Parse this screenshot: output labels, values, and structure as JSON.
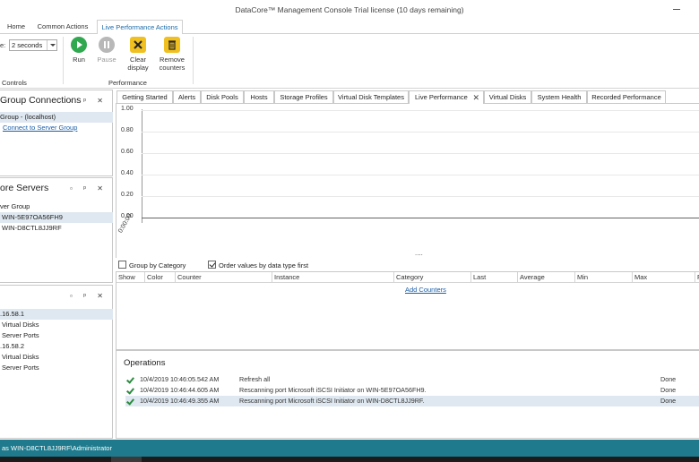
{
  "window": {
    "title": "DataCore™ Management Console   Trial license (10 days remaining)"
  },
  "ribbon": {
    "tabs": [
      "Home",
      "Common Actions",
      "Live Performance Actions"
    ],
    "active_tab": "Live Performance Actions",
    "interval_label": "e:",
    "interval_value": "2 seconds",
    "controls_group_label": "Controls",
    "performance_group_label": "Performance",
    "buttons": {
      "run": "Run",
      "pause": "Pause",
      "clear_line1": "Clear",
      "clear_line2": "display",
      "remove_line1": "Remove",
      "remove_line2": "counters"
    }
  },
  "panels": {
    "group_connections": {
      "title": "Group Connections",
      "items": [
        "Group - (localhost)",
        "Connect to Server Group"
      ]
    },
    "servers": {
      "title": "ore Servers",
      "items": [
        "ver Group",
        "WIN-5E97OA56FH9",
        "WIN-D8CTL8JJ9RF"
      ]
    },
    "ports": {
      "items": [
        ".16.58.1",
        "Virtual Disks",
        "Server Ports",
        ".16.58.2",
        "Virtual Disks",
        "Server Ports"
      ]
    }
  },
  "main_tabs": [
    "Getting Started",
    "Alerts",
    "Disk Pools",
    "Hosts",
    "Storage Profiles",
    "Virtual Disk Templates",
    "Live Performance",
    "Virtual Disks",
    "System Health",
    "Recorded Performance"
  ],
  "active_main_tab": "Live Performance",
  "chart_data": {
    "type": "line",
    "yticks": [
      "1.00",
      "0.80",
      "0.60",
      "0.40",
      "0.20",
      "0.00"
    ],
    "ylim": [
      0,
      1
    ],
    "xticks": [
      "0:00:00"
    ],
    "series": []
  },
  "chart_overflow": "....",
  "options": {
    "group_by_category": "Group by Category",
    "group_by_category_checked": false,
    "order_values": "Order values by data type first",
    "order_values_checked": true
  },
  "counters_table": {
    "columns": [
      "Show",
      "Color",
      "Counter",
      "Instance",
      "Category",
      "Last",
      "Average",
      "Min",
      "Max",
      "F"
    ],
    "add_link": "Add Counters"
  },
  "operations": {
    "title": "Operations",
    "rows": [
      {
        "time": "10/4/2019 10:46:05.542 AM",
        "message": "Refresh all",
        "status": "Done"
      },
      {
        "time": "10/4/2019 10:46:44.605 AM",
        "message": "Rescanning port Microsoft iSCSI Initiator on WIN-5E97OA56FH9.",
        "status": "Done"
      },
      {
        "time": "10/4/2019 10:46:49.355 AM",
        "message": "Rescanning port Microsoft iSCSI Initiator on WIN-D8CTL8JJ9RF.",
        "status": "Done"
      }
    ]
  },
  "status_bar": {
    "text": "as WIN-D8CTL8JJ9RF\\Administrator"
  },
  "colors": {
    "accent": "#1a6aa8",
    "status_bar": "#1e7a8c",
    "run_green": "#2fa84f",
    "done_check": "#2a8a3e"
  },
  "icons": {
    "run": "play-icon",
    "pause": "pause-icon",
    "clear": "clear-icon",
    "remove": "trash-icon"
  }
}
